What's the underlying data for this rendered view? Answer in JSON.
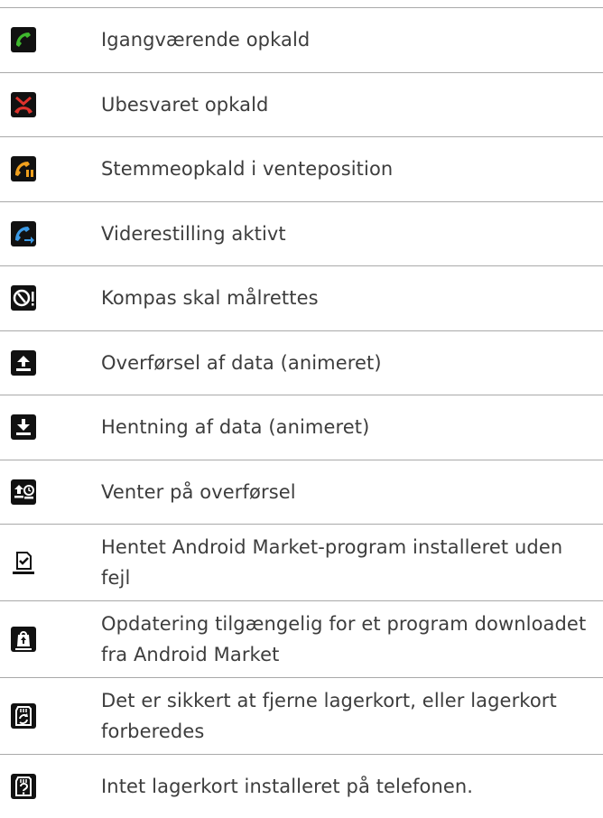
{
  "rows": [
    {
      "icon": "call-in-progress-icon",
      "label": "Igangværende opkald"
    },
    {
      "icon": "missed-call-icon",
      "label": "Ubesvaret opkald"
    },
    {
      "icon": "call-on-hold-icon",
      "label": "Stemmeopkald i venteposition"
    },
    {
      "icon": "call-forwarding-icon",
      "label": "Viderestilling aktivt"
    },
    {
      "icon": "compass-calibrate-icon",
      "label": "Kompas skal målrettes"
    },
    {
      "icon": "upload-icon",
      "label": "Overførsel af data (animeret)"
    },
    {
      "icon": "download-icon",
      "label": "Hentning af data (animeret)"
    },
    {
      "icon": "upload-waiting-icon",
      "label": "Venter på overførsel"
    },
    {
      "icon": "app-installed-icon",
      "label": "Hentet Android Market-program installeret uden fejl"
    },
    {
      "icon": "app-update-icon",
      "label": "Opdatering tilgængelig for et program downloadet fra Android Market"
    },
    {
      "icon": "sd-card-safe-remove-icon",
      "label": "Det er sikkert at fjerne lagerkort, eller lagerkort forberedes"
    },
    {
      "icon": "no-sd-card-icon",
      "label": "Intet lagerkort installeret på telefonen."
    }
  ],
  "colors": {
    "call_green": "#3fb82e",
    "missed_red": "#e0322c",
    "hold_orange": "#f0a01e",
    "forward_blue": "#3b9ae6",
    "icon_dark": "#111111",
    "divider": "#a9a9a9",
    "text": "#3d3d3d"
  }
}
